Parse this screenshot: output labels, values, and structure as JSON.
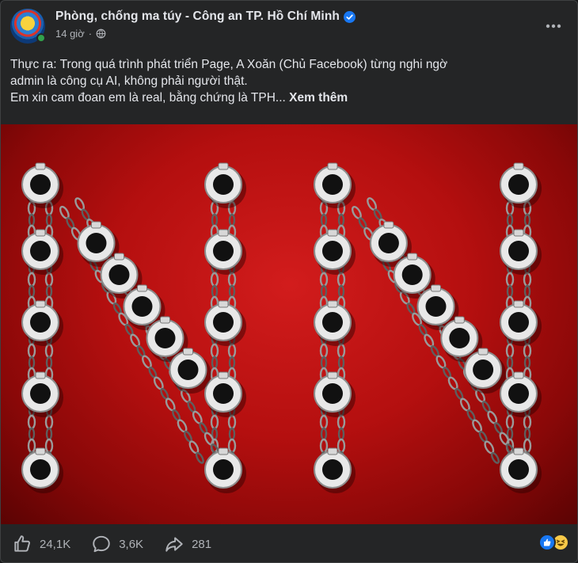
{
  "post": {
    "page_name": "Phòng, chống ma túy - Công an TP. Hồ Chí Minh",
    "time": "14 giờ",
    "dot": "·",
    "text_line1": "Thực ra: Trong quá trình phát triển Page, A Xoăn (Chủ Facebook) từng nghi ngờ",
    "text_line2": "admin là công cụ AI, không phải người thật.",
    "text_line3": "Em xin cam đoan em là real, bằng chứng là TPH... ",
    "see_more": "Xem thêm"
  },
  "stats": {
    "likes": "24,1K",
    "comments": "3,6K",
    "shares": "281"
  },
  "icons": {
    "verified": "verified-badge-icon",
    "privacy": "globe-icon",
    "more": "more-options-icon",
    "like": "like-icon",
    "comment": "comment-icon",
    "share": "share-icon"
  },
  "colors": {
    "background": "#242526",
    "text": "#e4e6eb",
    "secondary_text": "#b0b3b8",
    "verified_blue": "#1877f2",
    "image_red": "#c41212"
  }
}
